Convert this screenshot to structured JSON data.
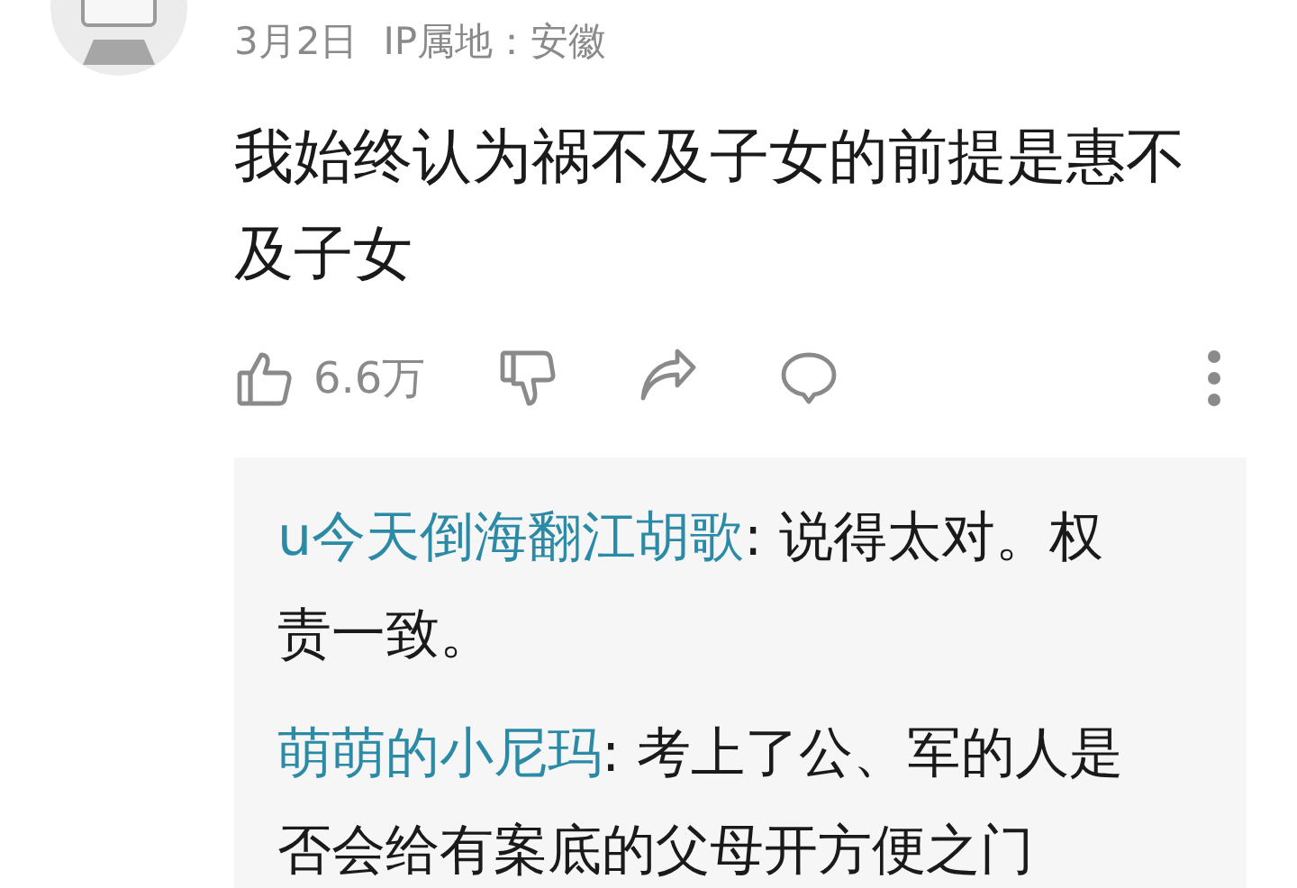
{
  "comment": {
    "date": "3月2日",
    "ip_location": "IP属地：安徽",
    "text": "我始终认为祸不及子女的前提是惠不及子女"
  },
  "actions": {
    "likes": "6.6万"
  },
  "replies": [
    {
      "author": "u今天倒海翻江胡歌",
      "text": ": 说得太对。权责一致。"
    },
    {
      "author": "萌萌的小尼玛",
      "text": ": 考上了公、军的人是否会给有案底的父母开方便之门"
    }
  ]
}
